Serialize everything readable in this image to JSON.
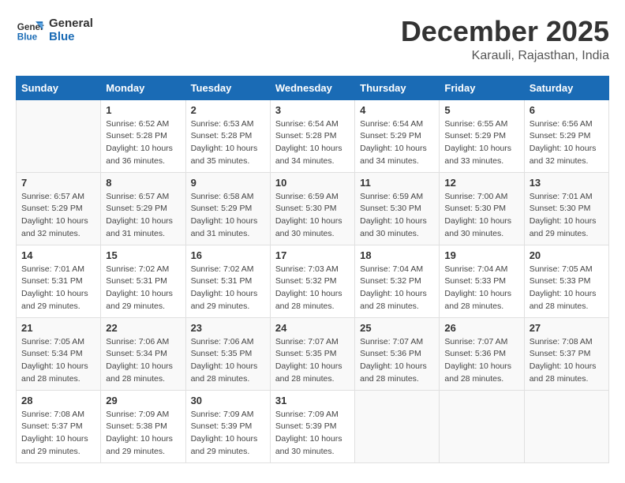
{
  "header": {
    "logo_line1": "General",
    "logo_line2": "Blue",
    "month": "December 2025",
    "location": "Karauli, Rajasthan, India"
  },
  "weekdays": [
    "Sunday",
    "Monday",
    "Tuesday",
    "Wednesday",
    "Thursday",
    "Friday",
    "Saturday"
  ],
  "weeks": [
    [
      {
        "day": "",
        "info": ""
      },
      {
        "day": "1",
        "info": "Sunrise: 6:52 AM\nSunset: 5:28 PM\nDaylight: 10 hours\nand 36 minutes."
      },
      {
        "day": "2",
        "info": "Sunrise: 6:53 AM\nSunset: 5:28 PM\nDaylight: 10 hours\nand 35 minutes."
      },
      {
        "day": "3",
        "info": "Sunrise: 6:54 AM\nSunset: 5:28 PM\nDaylight: 10 hours\nand 34 minutes."
      },
      {
        "day": "4",
        "info": "Sunrise: 6:54 AM\nSunset: 5:29 PM\nDaylight: 10 hours\nand 34 minutes."
      },
      {
        "day": "5",
        "info": "Sunrise: 6:55 AM\nSunset: 5:29 PM\nDaylight: 10 hours\nand 33 minutes."
      },
      {
        "day": "6",
        "info": "Sunrise: 6:56 AM\nSunset: 5:29 PM\nDaylight: 10 hours\nand 32 minutes."
      }
    ],
    [
      {
        "day": "7",
        "info": "Sunrise: 6:57 AM\nSunset: 5:29 PM\nDaylight: 10 hours\nand 32 minutes."
      },
      {
        "day": "8",
        "info": "Sunrise: 6:57 AM\nSunset: 5:29 PM\nDaylight: 10 hours\nand 31 minutes."
      },
      {
        "day": "9",
        "info": "Sunrise: 6:58 AM\nSunset: 5:29 PM\nDaylight: 10 hours\nand 31 minutes."
      },
      {
        "day": "10",
        "info": "Sunrise: 6:59 AM\nSunset: 5:30 PM\nDaylight: 10 hours\nand 30 minutes."
      },
      {
        "day": "11",
        "info": "Sunrise: 6:59 AM\nSunset: 5:30 PM\nDaylight: 10 hours\nand 30 minutes."
      },
      {
        "day": "12",
        "info": "Sunrise: 7:00 AM\nSunset: 5:30 PM\nDaylight: 10 hours\nand 30 minutes."
      },
      {
        "day": "13",
        "info": "Sunrise: 7:01 AM\nSunset: 5:30 PM\nDaylight: 10 hours\nand 29 minutes."
      }
    ],
    [
      {
        "day": "14",
        "info": "Sunrise: 7:01 AM\nSunset: 5:31 PM\nDaylight: 10 hours\nand 29 minutes."
      },
      {
        "day": "15",
        "info": "Sunrise: 7:02 AM\nSunset: 5:31 PM\nDaylight: 10 hours\nand 29 minutes."
      },
      {
        "day": "16",
        "info": "Sunrise: 7:02 AM\nSunset: 5:31 PM\nDaylight: 10 hours\nand 29 minutes."
      },
      {
        "day": "17",
        "info": "Sunrise: 7:03 AM\nSunset: 5:32 PM\nDaylight: 10 hours\nand 28 minutes."
      },
      {
        "day": "18",
        "info": "Sunrise: 7:04 AM\nSunset: 5:32 PM\nDaylight: 10 hours\nand 28 minutes."
      },
      {
        "day": "19",
        "info": "Sunrise: 7:04 AM\nSunset: 5:33 PM\nDaylight: 10 hours\nand 28 minutes."
      },
      {
        "day": "20",
        "info": "Sunrise: 7:05 AM\nSunset: 5:33 PM\nDaylight: 10 hours\nand 28 minutes."
      }
    ],
    [
      {
        "day": "21",
        "info": "Sunrise: 7:05 AM\nSunset: 5:34 PM\nDaylight: 10 hours\nand 28 minutes."
      },
      {
        "day": "22",
        "info": "Sunrise: 7:06 AM\nSunset: 5:34 PM\nDaylight: 10 hours\nand 28 minutes."
      },
      {
        "day": "23",
        "info": "Sunrise: 7:06 AM\nSunset: 5:35 PM\nDaylight: 10 hours\nand 28 minutes."
      },
      {
        "day": "24",
        "info": "Sunrise: 7:07 AM\nSunset: 5:35 PM\nDaylight: 10 hours\nand 28 minutes."
      },
      {
        "day": "25",
        "info": "Sunrise: 7:07 AM\nSunset: 5:36 PM\nDaylight: 10 hours\nand 28 minutes."
      },
      {
        "day": "26",
        "info": "Sunrise: 7:07 AM\nSunset: 5:36 PM\nDaylight: 10 hours\nand 28 minutes."
      },
      {
        "day": "27",
        "info": "Sunrise: 7:08 AM\nSunset: 5:37 PM\nDaylight: 10 hours\nand 28 minutes."
      }
    ],
    [
      {
        "day": "28",
        "info": "Sunrise: 7:08 AM\nSunset: 5:37 PM\nDaylight: 10 hours\nand 29 minutes."
      },
      {
        "day": "29",
        "info": "Sunrise: 7:09 AM\nSunset: 5:38 PM\nDaylight: 10 hours\nand 29 minutes."
      },
      {
        "day": "30",
        "info": "Sunrise: 7:09 AM\nSunset: 5:39 PM\nDaylight: 10 hours\nand 29 minutes."
      },
      {
        "day": "31",
        "info": "Sunrise: 7:09 AM\nSunset: 5:39 PM\nDaylight: 10 hours\nand 30 minutes."
      },
      {
        "day": "",
        "info": ""
      },
      {
        "day": "",
        "info": ""
      },
      {
        "day": "",
        "info": ""
      }
    ]
  ]
}
